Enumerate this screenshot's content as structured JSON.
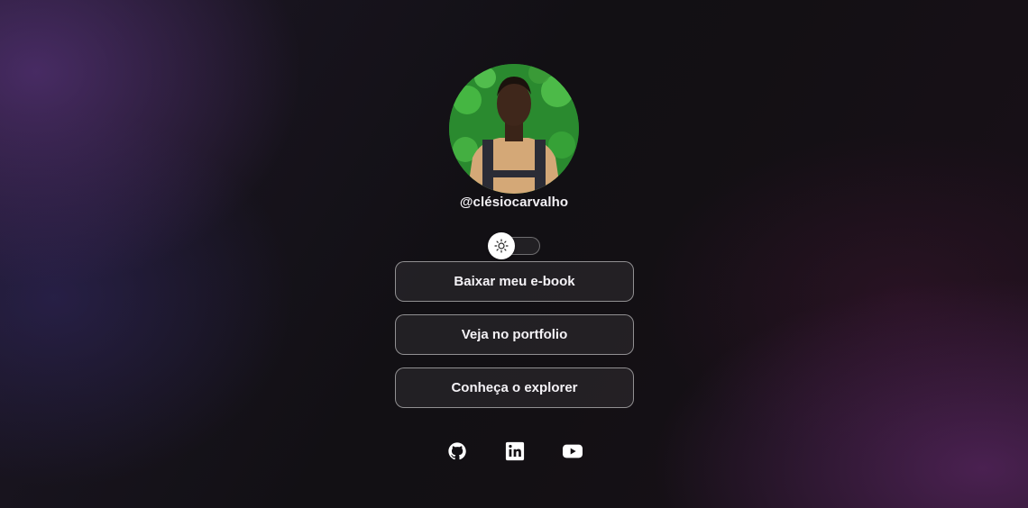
{
  "profile": {
    "handle": "@clésiocarvalho",
    "avatar_alt": "profile photo"
  },
  "theme_switch": {
    "icon": "sun-icon",
    "state": "off"
  },
  "links": [
    {
      "label": "Baixar meu e-book"
    },
    {
      "label": "Veja no portfolio"
    },
    {
      "label": "Conheça o explorer"
    }
  ],
  "social": [
    {
      "icon": "github-icon"
    },
    {
      "icon": "linkedin-icon"
    },
    {
      "icon": "youtube-icon"
    }
  ],
  "colors": {
    "background": "#121014",
    "accent_purple": "#563278",
    "button_border": "#ffffff",
    "text": "#f4f2f6"
  }
}
